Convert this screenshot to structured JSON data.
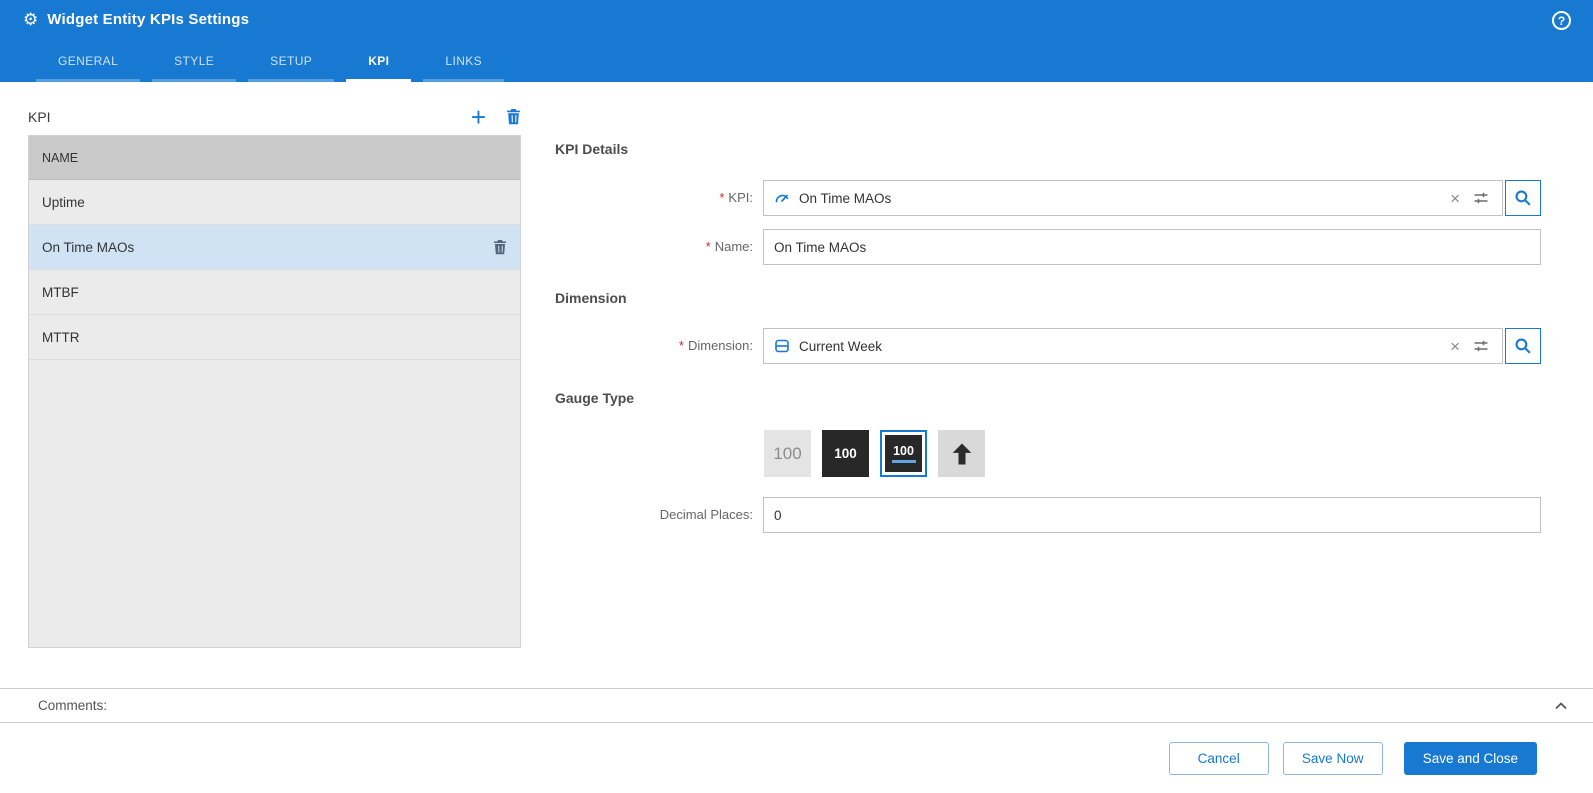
{
  "window": {
    "title": "Widget Entity KPIs Settings",
    "help_icon": "?"
  },
  "tabs": [
    {
      "label": "GENERAL"
    },
    {
      "label": "STYLE"
    },
    {
      "label": "SETUP"
    },
    {
      "label": "KPI"
    },
    {
      "label": "LINKS"
    }
  ],
  "active_tab": "KPI",
  "kpi_list": {
    "title": "KPI",
    "column_header": "NAME",
    "rows": [
      {
        "name": "Uptime"
      },
      {
        "name": "On Time MAOs"
      },
      {
        "name": "MTBF"
      },
      {
        "name": "MTTR"
      }
    ],
    "selected_row": "On Time MAOs"
  },
  "form": {
    "required_marker": "*",
    "clear_icon": "×",
    "sections": {
      "kpi_details": "KPI Details",
      "dimension": "Dimension",
      "gauge_type": "Gauge Type"
    },
    "fields": {
      "kpi": {
        "label": "KPI:",
        "value": "On Time MAOs"
      },
      "name": {
        "label": "Name:",
        "value": "On Time MAOs"
      },
      "dimension": {
        "label": "Dimension:",
        "value": "Current Week"
      },
      "decimal_places": {
        "label": "Decimal Places:",
        "value": "0"
      }
    },
    "gauge_options": [
      {
        "label": "100",
        "style": "plain",
        "selected": false
      },
      {
        "label": "100",
        "style": "dark",
        "selected": false
      },
      {
        "label": "100",
        "style": "dark-underline",
        "selected": true
      },
      {
        "label": "",
        "style": "up-arrow",
        "selected": false
      }
    ]
  },
  "comments": {
    "label": "Comments:"
  },
  "footer": {
    "cancel_label": "Cancel",
    "save_now_label": "Save Now",
    "save_and_close_label": "Save and Close"
  },
  "colors": {
    "header_blue": "#1779d1",
    "accent_blue": "#1779d1",
    "selected_row_blue": "#cfe3f5",
    "required_red": "#c03030"
  }
}
